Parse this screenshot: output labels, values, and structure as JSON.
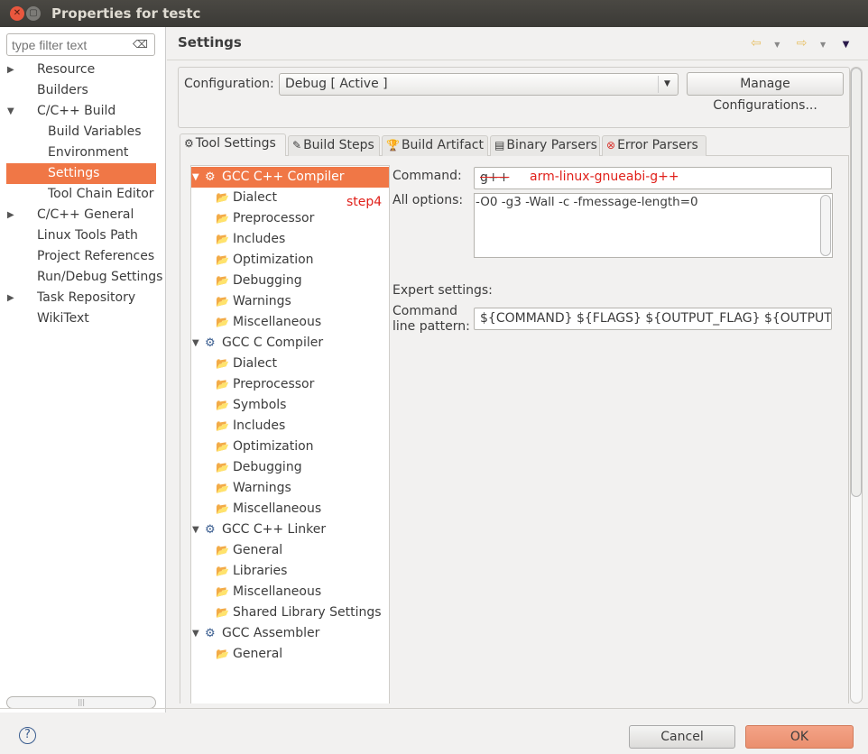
{
  "window": {
    "title": "Properties for testc"
  },
  "filter": {
    "placeholder": "type filter text"
  },
  "nav": [
    {
      "label": "Resource",
      "level": 0,
      "arrow": "right"
    },
    {
      "label": "Builders",
      "level": 0
    },
    {
      "label": "C/C++ Build",
      "level": 0,
      "arrow": "down"
    },
    {
      "label": "Build Variables",
      "level": 1
    },
    {
      "label": "Environment",
      "level": 1
    },
    {
      "label": "Settings",
      "level": 1,
      "selected": true
    },
    {
      "label": "Tool Chain Editor",
      "level": 1
    },
    {
      "label": "C/C++ General",
      "level": 0,
      "arrow": "right"
    },
    {
      "label": "Linux Tools Path",
      "level": 0
    },
    {
      "label": "Project References",
      "level": 0
    },
    {
      "label": "Run/Debug Settings",
      "level": 0
    },
    {
      "label": "Task Repository",
      "level": 0,
      "arrow": "right"
    },
    {
      "label": "WikiText",
      "level": 0
    }
  ],
  "page": {
    "heading": "Settings"
  },
  "config": {
    "label": "Configuration:",
    "value": "Debug  [ Active ]",
    "manage_label": "Manage Configurations..."
  },
  "tabs": [
    {
      "label": "Tool Settings",
      "icon": "tool-settings-icon",
      "active": true
    },
    {
      "label": "Build Steps",
      "icon": "build-steps-icon"
    },
    {
      "label": "Build Artifact",
      "icon": "build-artifact-icon"
    },
    {
      "label": "Binary Parsers",
      "icon": "binary-parsers-icon"
    },
    {
      "label": "Error Parsers",
      "icon": "error-parsers-icon"
    }
  ],
  "tree": [
    {
      "label": "GCC C++ Compiler",
      "level": 0,
      "selected": true
    },
    {
      "label": "Dialect",
      "level": 1
    },
    {
      "label": "Preprocessor",
      "level": 1
    },
    {
      "label": "Includes",
      "level": 1
    },
    {
      "label": "Optimization",
      "level": 1
    },
    {
      "label": "Debugging",
      "level": 1
    },
    {
      "label": "Warnings",
      "level": 1
    },
    {
      "label": "Miscellaneous",
      "level": 1
    },
    {
      "label": "GCC C Compiler",
      "level": 0
    },
    {
      "label": "Dialect",
      "level": 1
    },
    {
      "label": "Preprocessor",
      "level": 1
    },
    {
      "label": "Symbols",
      "level": 1
    },
    {
      "label": "Includes",
      "level": 1
    },
    {
      "label": "Optimization",
      "level": 1
    },
    {
      "label": "Debugging",
      "level": 1
    },
    {
      "label": "Warnings",
      "level": 1
    },
    {
      "label": "Miscellaneous",
      "level": 1
    },
    {
      "label": "GCC C++ Linker",
      "level": 0
    },
    {
      "label": "General",
      "level": 1
    },
    {
      "label": "Libraries",
      "level": 1
    },
    {
      "label": "Miscellaneous",
      "level": 1
    },
    {
      "label": "Shared Library Settings",
      "level": 1
    },
    {
      "label": "GCC Assembler",
      "level": 0
    },
    {
      "label": "General",
      "level": 1
    }
  ],
  "annotation": {
    "step": "step4",
    "new_command": "arm-linux-gnueabi-g++",
    "color": "#e0201a"
  },
  "settings": {
    "command_label": "Command:",
    "command_value": "g++",
    "all_options_label": "All options:",
    "all_options_value": "-O0 -g3 -Wall -c -fmessage-length=0",
    "expert_label": "Expert settings:",
    "pattern_label_1": "Command",
    "pattern_label_2": "line pattern:",
    "pattern_value": "${COMMAND} ${FLAGS} ${OUTPUT_FLAG} ${OUTPUT_PREFIX}${OUTPUT} ${INPUTS}"
  },
  "buttons": {
    "cancel": "Cancel",
    "ok": "OK",
    "help": "?"
  },
  "accent": "#f07746"
}
